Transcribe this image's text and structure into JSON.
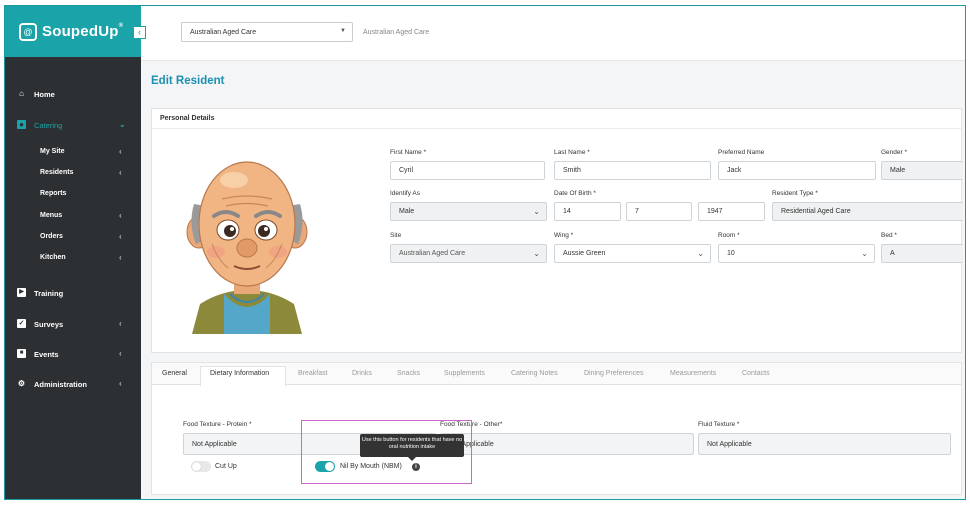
{
  "brand": {
    "name": "SoupedUp",
    "trademark": "®",
    "logo_glyph": "@"
  },
  "colors": {
    "accent": "#1aa3a8",
    "title": "#1a8fb4",
    "sidebar": "#2d3033",
    "highlight": "#c86bc8"
  },
  "topbar": {
    "site_value": "Australian Aged Care",
    "breadcrumb": "Australian Aged Care"
  },
  "sidebar": {
    "items": [
      {
        "label": "Home",
        "icon": "home-icon"
      },
      {
        "label": "Catering",
        "icon": "catering-icon"
      },
      {
        "label": "Training",
        "icon": "play-icon"
      },
      {
        "label": "Surveys",
        "icon": "clipboard-icon"
      },
      {
        "label": "Events",
        "icon": "calendar-icon"
      },
      {
        "label": "Administration",
        "icon": "gear-icon"
      }
    ],
    "catering_sub": [
      "My Site",
      "Residents",
      "Reports",
      "Menus",
      "Orders",
      "Kitchen"
    ]
  },
  "page": {
    "title": "Edit Resident"
  },
  "personal": {
    "header": "Personal Details",
    "first_name": {
      "label": "First Name *",
      "value": "Cyril"
    },
    "last_name": {
      "label": "Last Name *",
      "value": "Smith"
    },
    "preferred_name": {
      "label": "Preferred Name",
      "value": "Jack"
    },
    "gender": {
      "label": "Gender *",
      "value": "Male"
    },
    "identify_as": {
      "label": "Identify As",
      "value": "Male"
    },
    "dob": {
      "label": "Date Of Birth *",
      "day": "14",
      "month": "7",
      "year": "1947"
    },
    "resident_type": {
      "label": "Resident Type *",
      "value": "Residential Aged Care"
    },
    "site": {
      "label": "Site",
      "value": "Australian Aged Care"
    },
    "wing": {
      "label": "Wing *",
      "value": "Aussie Green"
    },
    "room": {
      "label": "Room *",
      "value": "10"
    },
    "bed": {
      "label": "Bed *",
      "value": "A"
    }
  },
  "tabs": [
    "General",
    "Dietary Information",
    "Breakfast",
    "Drinks",
    "Snacks",
    "Supplements",
    "Catering Notes",
    "Dining Preferences",
    "Measurements",
    "Contacts"
  ],
  "dietary": {
    "food_texture_protein": {
      "label": "Food Texture - Protein *",
      "value": "Not Applicable"
    },
    "food_texture_other": {
      "label": "Food Texture - Other*",
      "value": "Not Applicable"
    },
    "fluid_texture": {
      "label": "Fluid Texture *",
      "value": "Not Applicable"
    },
    "cut_up": {
      "label": "Cut Up",
      "on": false
    },
    "nbm": {
      "label": "Nil By Mouth (NBM)",
      "on": true
    },
    "tooltip": "Use this button for residents that have no oral nutrition intake"
  }
}
